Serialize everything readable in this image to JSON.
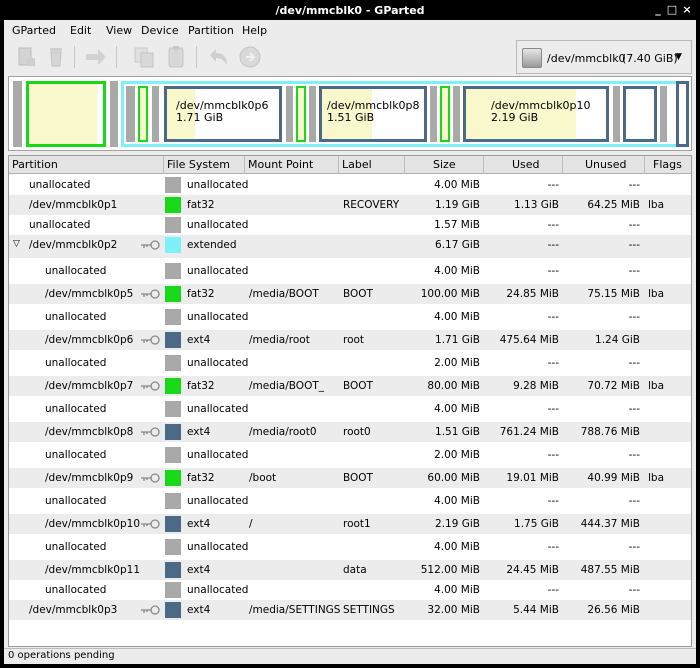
{
  "window": {
    "title": "/dev/mmcblk0 - GParted",
    "minimize": "_",
    "maximize": "□",
    "close": "×"
  },
  "menu": [
    "GParted",
    "Edit",
    "View",
    "Device",
    "Partition",
    "Help"
  ],
  "device": {
    "name": "/dev/mmcblk0",
    "size": "(7.40 GiB)",
    "arrow": "▼"
  },
  "map_labels": [
    {
      "name": "/dev/mmcblk0p6",
      "size": "1.71 GiB"
    },
    {
      "name": "/dev/mmcblk0p8",
      "size": "1.51 GiB"
    },
    {
      "name": "/dev/mmcblk0p10",
      "size": "2.19 GiB"
    }
  ],
  "columns": [
    "Partition",
    "File System",
    "Mount Point",
    "Label",
    "Size",
    "Used",
    "Unused",
    "Flags"
  ],
  "rows": [
    {
      "part": "unallocated",
      "fs": "unallocated",
      "mount": "",
      "label": "",
      "size": "4.00 MiB",
      "used": "---",
      "unused": "---",
      "flags": "",
      "color": "#a9a9a9",
      "indent": 1,
      "key": false,
      "expand": false
    },
    {
      "part": "/dev/mmcblk0p1",
      "fs": "fat32",
      "mount": "",
      "label": "RECOVERY",
      "size": "1.19 GiB",
      "used": "1.13 GiB",
      "unused": "64.25 MiB",
      "flags": "lba",
      "color": "#18d818",
      "indent": 1,
      "key": false,
      "expand": false
    },
    {
      "part": "unallocated",
      "fs": "unallocated",
      "mount": "",
      "label": "",
      "size": "1.57 MiB",
      "used": "---",
      "unused": "---",
      "flags": "",
      "color": "#a9a9a9",
      "indent": 1,
      "key": false,
      "expand": false
    },
    {
      "part": "/dev/mmcblk0p2",
      "fs": "extended",
      "mount": "",
      "label": "",
      "size": "6.17 GiB",
      "used": "---",
      "unused": "---",
      "flags": "",
      "color": "#7ef0f8",
      "indent": 1,
      "key": true,
      "expand": true
    },
    {
      "part": "unallocated",
      "fs": "unallocated",
      "mount": "",
      "label": "",
      "size": "4.00 MiB",
      "used": "---",
      "unused": "---",
      "flags": "",
      "color": "#a9a9a9",
      "indent": 2,
      "key": false,
      "expand": false
    },
    {
      "part": "/dev/mmcblk0p5",
      "fs": "fat32",
      "mount": "/media/BOOT",
      "label": "BOOT",
      "size": "100.00 MiB",
      "used": "24.85 MiB",
      "unused": "75.15 MiB",
      "flags": "lba",
      "color": "#18d818",
      "indent": 2,
      "key": true,
      "expand": false
    },
    {
      "part": "unallocated",
      "fs": "unallocated",
      "mount": "",
      "label": "",
      "size": "4.00 MiB",
      "used": "---",
      "unused": "---",
      "flags": "",
      "color": "#a9a9a9",
      "indent": 2,
      "key": false,
      "expand": false
    },
    {
      "part": "/dev/mmcblk0p6",
      "fs": "ext4",
      "mount": "/media/root",
      "label": "root",
      "size": "1.71 GiB",
      "used": "475.64 MiB",
      "unused": "1.24 GiB",
      "flags": "",
      "color": "#4c6a86",
      "indent": 2,
      "key": true,
      "expand": false
    },
    {
      "part": "unallocated",
      "fs": "unallocated",
      "mount": "",
      "label": "",
      "size": "2.00 MiB",
      "used": "---",
      "unused": "---",
      "flags": "",
      "color": "#a9a9a9",
      "indent": 2,
      "key": false,
      "expand": false
    },
    {
      "part": "/dev/mmcblk0p7",
      "fs": "fat32",
      "mount": "/media/BOOT_",
      "label": "BOOT",
      "size": "80.00 MiB",
      "used": "9.28 MiB",
      "unused": "70.72 MiB",
      "flags": "lba",
      "color": "#18d818",
      "indent": 2,
      "key": true,
      "expand": false
    },
    {
      "part": "unallocated",
      "fs": "unallocated",
      "mount": "",
      "label": "",
      "size": "4.00 MiB",
      "used": "---",
      "unused": "---",
      "flags": "",
      "color": "#a9a9a9",
      "indent": 2,
      "key": false,
      "expand": false
    },
    {
      "part": "/dev/mmcblk0p8",
      "fs": "ext4",
      "mount": "/media/root0",
      "label": "root0",
      "size": "1.51 GiB",
      "used": "761.24 MiB",
      "unused": "788.76 MiB",
      "flags": "",
      "color": "#4c6a86",
      "indent": 2,
      "key": true,
      "expand": false
    },
    {
      "part": "unallocated",
      "fs": "unallocated",
      "mount": "",
      "label": "",
      "size": "2.00 MiB",
      "used": "---",
      "unused": "---",
      "flags": "",
      "color": "#a9a9a9",
      "indent": 2,
      "key": false,
      "expand": false
    },
    {
      "part": "/dev/mmcblk0p9",
      "fs": "fat32",
      "mount": "/boot",
      "label": "BOOT",
      "size": "60.00 MiB",
      "used": "19.01 MiB",
      "unused": "40.99 MiB",
      "flags": "lba",
      "color": "#18d818",
      "indent": 2,
      "key": true,
      "expand": false
    },
    {
      "part": "unallocated",
      "fs": "unallocated",
      "mount": "",
      "label": "",
      "size": "4.00 MiB",
      "used": "---",
      "unused": "---",
      "flags": "",
      "color": "#a9a9a9",
      "indent": 2,
      "key": false,
      "expand": false
    },
    {
      "part": "/dev/mmcblk0p10",
      "fs": "ext4",
      "mount": "/",
      "label": "root1",
      "size": "2.19 GiB",
      "used": "1.75 GiB",
      "unused": "444.37 MiB",
      "flags": "",
      "color": "#4c6a86",
      "indent": 2,
      "key": true,
      "expand": false
    },
    {
      "part": "unallocated",
      "fs": "unallocated",
      "mount": "",
      "label": "",
      "size": "4.00 MiB",
      "used": "---",
      "unused": "---",
      "flags": "",
      "color": "#a9a9a9",
      "indent": 2,
      "key": false,
      "expand": false
    },
    {
      "part": "/dev/mmcblk0p11",
      "fs": "ext4",
      "mount": "",
      "label": "data",
      "size": "512.00 MiB",
      "used": "24.45 MiB",
      "unused": "487.55 MiB",
      "flags": "",
      "color": "#4c6a86",
      "indent": 2,
      "key": false,
      "expand": false
    },
    {
      "part": "unallocated",
      "fs": "unallocated",
      "mount": "",
      "label": "",
      "size": "4.00 MiB",
      "used": "---",
      "unused": "---",
      "flags": "",
      "color": "#a9a9a9",
      "indent": 2,
      "key": false,
      "expand": false
    },
    {
      "part": "/dev/mmcblk0p3",
      "fs": "ext4",
      "mount": "/media/SETTINGS",
      "label": "SETTINGS",
      "size": "32.00 MiB",
      "used": "5.44 MiB",
      "unused": "26.56 MiB",
      "flags": "",
      "color": "#4c6a86",
      "indent": 1,
      "key": true,
      "expand": false
    }
  ],
  "status": "0 operations pending"
}
